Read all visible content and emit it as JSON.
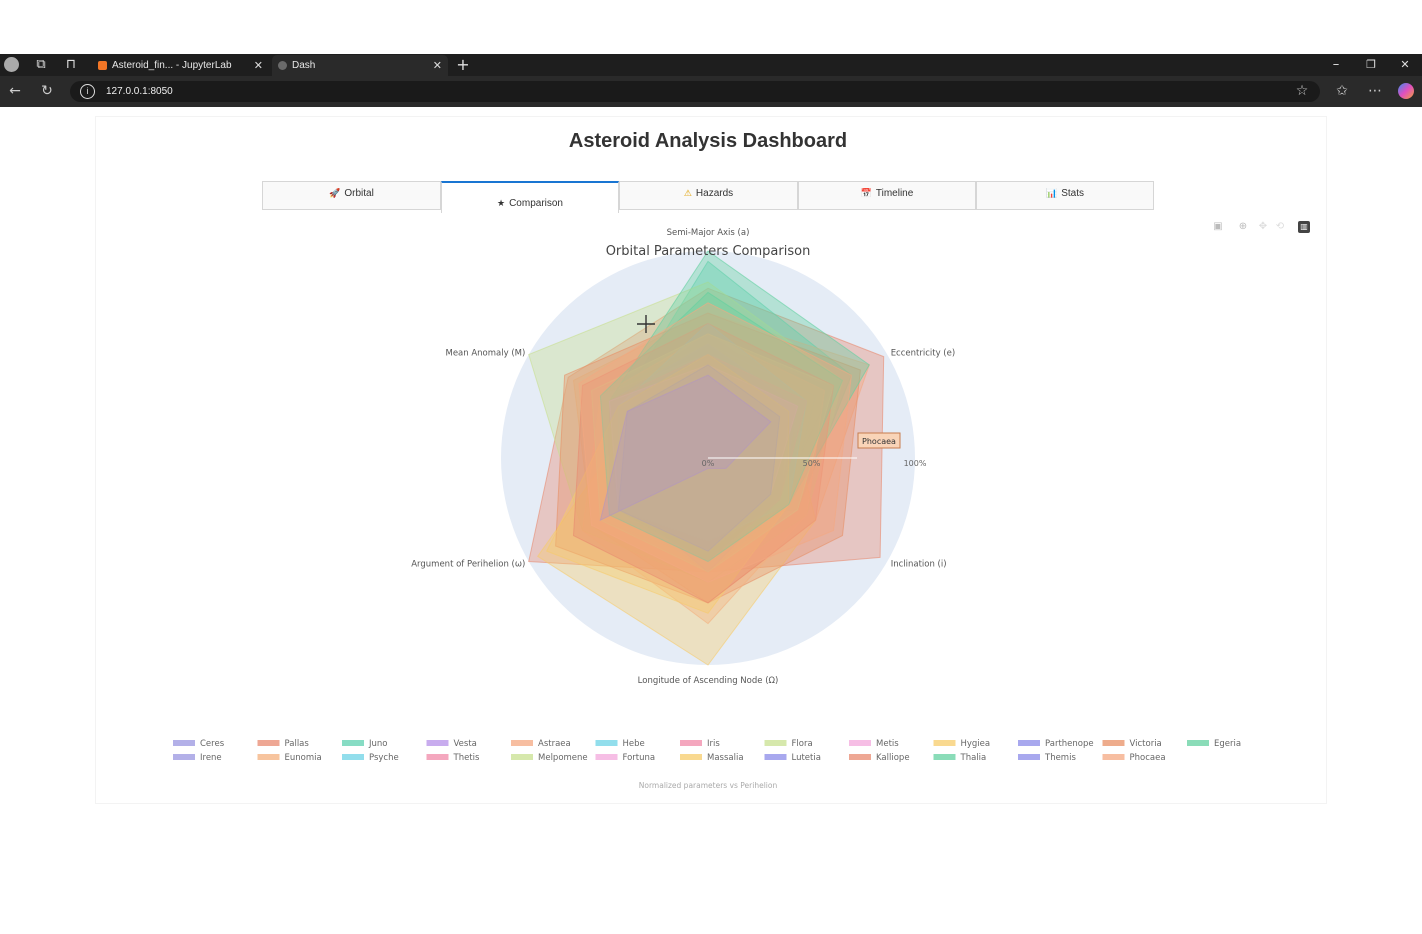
{
  "browser": {
    "tabs": [
      {
        "label": "Asteroid_fin... - JupyterLab",
        "favicon_color": "#f37626",
        "active": false
      },
      {
        "label": "Dash",
        "favicon_color": "#6a6a6a",
        "active": true
      }
    ],
    "new_tab": "+",
    "url": "127.0.0.1:8050",
    "window_controls": [
      "–",
      "❐",
      "✕"
    ]
  },
  "app": {
    "title": "Asteroid Analysis Dashboard",
    "tabs": [
      {
        "icon": "🚀",
        "label": "Orbital"
      },
      {
        "icon": "★",
        "label": "Comparison",
        "selected": true
      },
      {
        "icon": "⚠",
        "label": "Hazards"
      },
      {
        "icon": "📅",
        "label": "Timeline"
      },
      {
        "icon": "📊",
        "label": "Stats"
      }
    ]
  },
  "chart_data": {
    "type": "radar",
    "title": "Orbital Parameters Comparison",
    "axes": [
      "Semi-Major Axis (a)",
      "Eccentricity (e)",
      "Inclination (i)",
      "Longitude of Ascending Node (Ω)",
      "Argument of Perihelion (ω)",
      "Mean Anomaly (M)"
    ],
    "radial_ticks": [
      "0%",
      "50%",
      "100%"
    ],
    "radial_range": [
      0,
      100
    ],
    "hover_label": "Phocaea",
    "caption": "Normalized parameters vs Perihelion",
    "legend_position": "bottom",
    "series": [
      {
        "name": "Ceres",
        "color": "#9a96e0",
        "values": [
          60,
          55,
          40,
          50,
          60,
          55
        ]
      },
      {
        "name": "Pallas",
        "color": "#e88a70",
        "values": [
          82,
          98,
          96,
          55,
          100,
          78
        ]
      },
      {
        "name": "Juno",
        "color": "#5fd0b0",
        "values": [
          95,
          80,
          50,
          30,
          40,
          50
        ]
      },
      {
        "name": "Vesta",
        "color": "#b590e8",
        "values": [
          45,
          40,
          30,
          45,
          55,
          50
        ]
      },
      {
        "name": "Astraea",
        "color": "#f4a882",
        "values": [
          70,
          90,
          60,
          70,
          65,
          75
        ]
      },
      {
        "name": "Hebe",
        "color": "#6ed3e6",
        "values": [
          55,
          60,
          45,
          55,
          50,
          60
        ]
      },
      {
        "name": "Iris",
        "color": "#f08aa8",
        "values": [
          55,
          70,
          40,
          45,
          60,
          65
        ]
      },
      {
        "name": "Flora",
        "color": "#c8e090",
        "values": [
          85,
          75,
          55,
          60,
          70,
          100
        ]
      },
      {
        "name": "Metis",
        "color": "#f3a8dc",
        "values": [
          50,
          50,
          35,
          40,
          55,
          60
        ]
      },
      {
        "name": "Hygiea",
        "color": "#f7cc6b",
        "values": [
          40,
          45,
          60,
          100,
          95,
          40
        ]
      },
      {
        "name": "Parthenope",
        "color": "#8b8be8",
        "values": [
          50,
          45,
          40,
          55,
          45,
          50
        ]
      },
      {
        "name": "Victoria",
        "color": "#e89066",
        "values": [
          70,
          85,
          75,
          70,
          85,
          80
        ]
      },
      {
        "name": "Egeria",
        "color": "#63d0a0",
        "values": [
          100,
          90,
          45,
          50,
          50,
          55
        ]
      },
      {
        "name": "Irene",
        "color": "#9a96e0",
        "values": [
          55,
          50,
          40,
          45,
          50,
          55
        ]
      },
      {
        "name": "Eunomia",
        "color": "#f4b07e",
        "values": [
          60,
          65,
          55,
          80,
          70,
          60
        ]
      },
      {
        "name": "Psyche",
        "color": "#6ed3e6",
        "values": [
          65,
          55,
          45,
          40,
          50,
          50
        ]
      },
      {
        "name": "Thetis",
        "color": "#f08aa8",
        "values": [
          50,
          55,
          40,
          50,
          55,
          55
        ]
      },
      {
        "name": "Melpomene",
        "color": "#c8e090",
        "values": [
          60,
          70,
          50,
          55,
          60,
          65
        ]
      },
      {
        "name": "Fortuna",
        "color": "#f3a8dc",
        "values": [
          45,
          50,
          35,
          45,
          50,
          55
        ]
      },
      {
        "name": "Massalia",
        "color": "#f7cc6b",
        "values": [
          50,
          45,
          45,
          75,
          90,
          50
        ]
      },
      {
        "name": "Lutetia",
        "color": "#8b8be8",
        "values": [
          45,
          40,
          35,
          45,
          50,
          45
        ]
      },
      {
        "name": "Kalliope",
        "color": "#e88a70",
        "values": [
          65,
          70,
          60,
          70,
          75,
          70
        ]
      },
      {
        "name": "Thalia",
        "color": "#63d0a0",
        "values": [
          80,
          75,
          45,
          50,
          55,
          60
        ]
      },
      {
        "name": "Themis",
        "color": "#8b8be8",
        "values": [
          40,
          35,
          10,
          5,
          60,
          45
        ]
      },
      {
        "name": "Phocaea",
        "color": "#f4a882",
        "values": [
          75,
          80,
          70,
          60,
          65,
          72
        ]
      }
    ]
  }
}
